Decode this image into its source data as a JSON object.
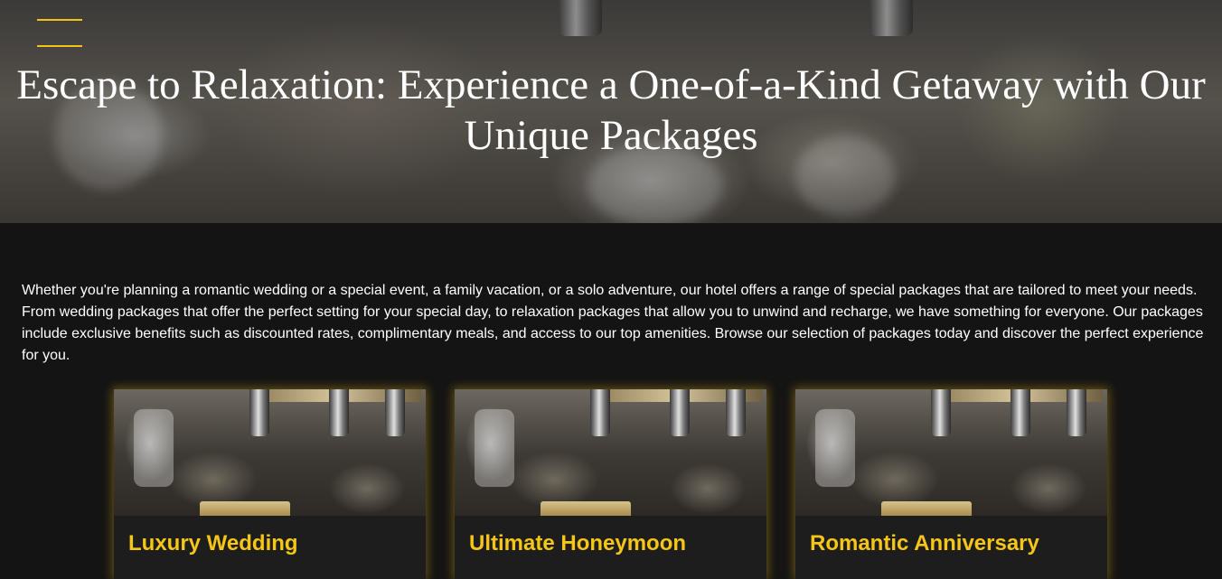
{
  "hero": {
    "title": "Escape to Relaxation: Experience a One-of-a-Kind Getaway with Our Unique Packages",
    "menu_icon": "hamburger-menu-icon"
  },
  "intro": {
    "text": "Whether you're planning a romantic wedding or a special event, a family vacation, or a solo adventure, our hotel offers a range of special packages that are tailored to meet your needs. From wedding packages that offer the perfect setting for your special day, to relaxation packages that allow you to unwind and recharge, we have something for everyone. Our packages include exclusive benefits such as discounted rates, complimentary meals, and access to our top amenities. Browse our selection of packages today and discover the perfect experience for you."
  },
  "packages": [
    {
      "title": "Luxury Wedding"
    },
    {
      "title": "Ultimate Honeymoon"
    },
    {
      "title": "Romantic Anniversary"
    }
  ],
  "colors": {
    "accent": "#f5c518",
    "background": "#141414",
    "card_bg": "#1d1d1d"
  }
}
